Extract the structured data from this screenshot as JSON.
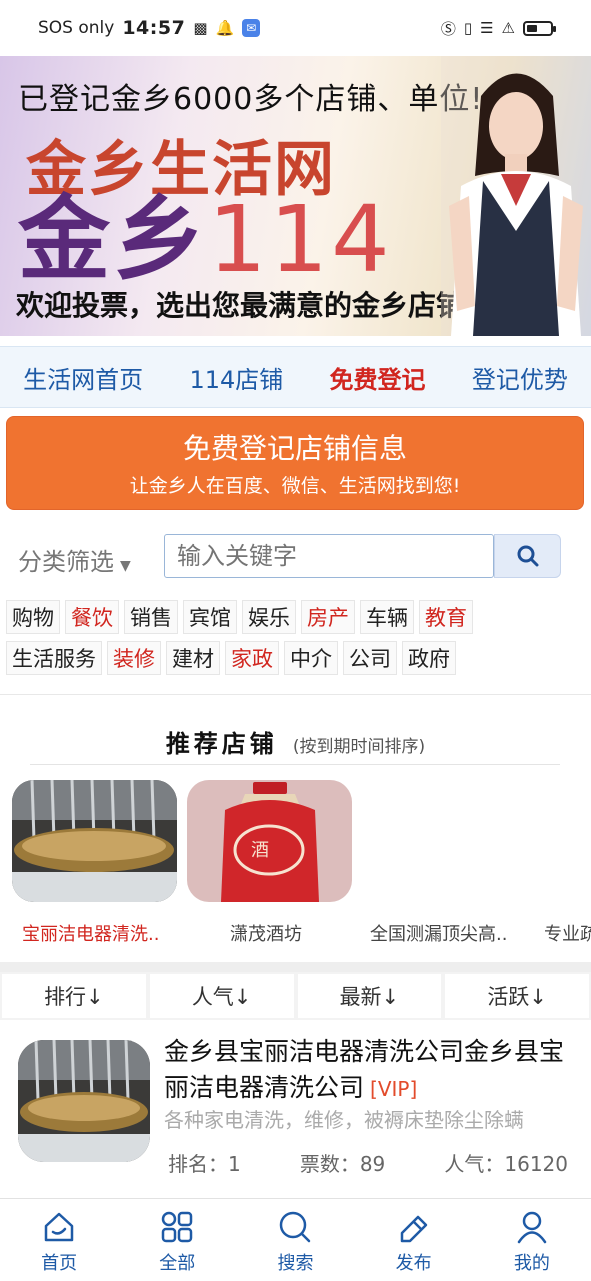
{
  "status_bar": {
    "carrier": "SOS only",
    "time": "14:57",
    "battery_level": 0.45
  },
  "banner": {
    "line1": "已登记金乡6000多个店铺、单位!",
    "line2": "金乡生活网",
    "line3_text": "金乡",
    "line3_num": "114",
    "line4": "欢迎投票，选出您最满意的金乡店铺!"
  },
  "nav": {
    "items": [
      "生活网首页",
      "114店铺",
      "免费登记",
      "登记优势"
    ]
  },
  "register": {
    "title": "免费登记店铺信息",
    "subtitle": "让金乡人在百度、微信、生活网找到您!"
  },
  "filter": {
    "label": "分类筛选",
    "placeholder": "输入关键字"
  },
  "categories": {
    "row1": [
      "购物",
      "餐饮",
      "销售",
      "宾馆",
      "娱乐",
      "房产",
      "车辆",
      "教育"
    ],
    "row2": [
      "生活服务",
      "装修",
      "建材",
      "家政",
      "中介",
      "公司",
      "政府"
    ]
  },
  "recommended": {
    "title": "推荐店铺",
    "subtitle": "(按到期时间排序)",
    "items": [
      "宝丽洁电器清洗..",
      "潇茂酒坊",
      "全国测漏顶尖高..",
      "专业疏"
    ]
  },
  "sort_tabs": [
    "排行↓",
    "人气↓",
    "最新↓",
    "活跃↓"
  ],
  "listing": {
    "title": "金乡县宝丽洁电器清洗公司金乡县宝丽洁电器清洗公司",
    "vip": "[VIP]",
    "desc": "各种家电清洗，维修，被褥床垫除尘除螨",
    "rank": "排名：1",
    "votes": "票数：89",
    "popularity": "人气：16120"
  },
  "tabbar": [
    "首页",
    "全部",
    "搜索",
    "发布",
    "我的"
  ],
  "colors": {
    "accent_blue": "#1e5aa6",
    "accent_red": "#d1261f",
    "register_orange": "#f07330"
  }
}
